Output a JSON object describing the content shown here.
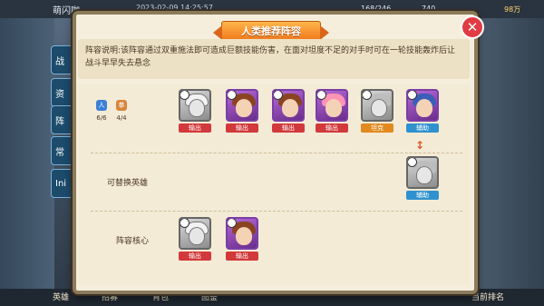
{
  "background": {
    "player_name": "萌闪咖",
    "time": "2023-02-09 14:25:57",
    "resource_1": "168/246",
    "resource_2": "740",
    "gold": "98万",
    "side_tabs": [
      "战",
      "资",
      "阵",
      "常",
      "Ini"
    ],
    "bottom_nav": [
      "英雄",
      "招募",
      "背包",
      "图鉴",
      "当前排名"
    ]
  },
  "dialog": {
    "title": "人类推荐阵容",
    "close_icon": "close-x-icon",
    "description": "阵容说明:该阵容通过双重施法即可造成巨额技能伤害，在面对坦度不足的对手时可在一轮技能轰炸后让战斗早早失去悬念",
    "summary": [
      {
        "icon": "human-race-icon",
        "value": "6/6"
      },
      {
        "icon": "warrior-class-icon",
        "value": "4/4"
      }
    ],
    "lineup": [
      {
        "role": "输出",
        "frame": "grey",
        "hair": "hair-white"
      },
      {
        "role": "输出",
        "frame": "purple",
        "hair": "hair-brown"
      },
      {
        "role": "输出",
        "frame": "purple",
        "hair": "hair-brown"
      },
      {
        "role": "输出",
        "frame": "purple",
        "hair": "hair-pink"
      },
      {
        "role": "坦克",
        "frame": "grey",
        "hair": "hair-grey"
      },
      {
        "role": "辅助",
        "frame": "purple",
        "hair": "hair-blue"
      }
    ],
    "replacement_label": "可替换英雄",
    "replacement": {
      "role": "辅助",
      "frame": "grey",
      "hair": "hair-grey"
    },
    "core_label": "阵容核心",
    "core": [
      {
        "role": "输出",
        "frame": "grey",
        "hair": "hair-white"
      },
      {
        "role": "输出",
        "frame": "purple",
        "hair": "hair-brown"
      }
    ],
    "colors": {
      "output": "#d2393c",
      "tank": "#e18a1f",
      "support": "#2f92cf",
      "accent": "#f07a1c"
    }
  }
}
